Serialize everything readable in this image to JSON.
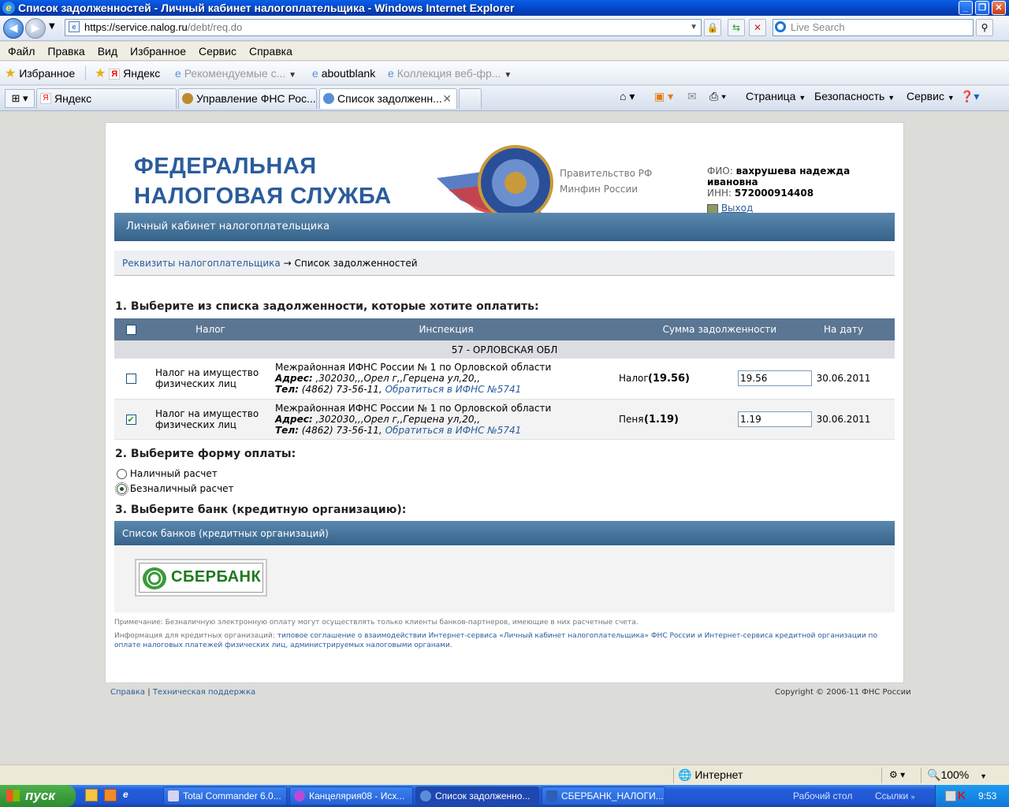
{
  "window": {
    "title": "Список задолженностей - Личный кабинет налогоплательщика - Windows Internet Explorer"
  },
  "address": {
    "domain": "https://service.nalog.ru",
    "path": "/debt/req.do"
  },
  "search": {
    "placeholder": "Live Search"
  },
  "menu": [
    "Файл",
    "Правка",
    "Вид",
    "Избранное",
    "Сервис",
    "Справка"
  ],
  "favbar": {
    "favorites": "Избранное",
    "items": [
      "Яндекс",
      "Рекомендуемые с...",
      "aboutblank",
      "Коллекция веб-фр..."
    ]
  },
  "tabs": [
    {
      "label": "Яндекс"
    },
    {
      "label": "Управление ФНС Рос..."
    },
    {
      "label": "Список задолженн..."
    }
  ],
  "toolbar": {
    "page": "Страница",
    "security": "Безопасность",
    "service": "Сервис"
  },
  "site": {
    "logo_line1": "ФЕДЕРАЛЬНАЯ",
    "logo_line2": "НАЛОГОВАЯ СЛУЖБА",
    "link_gov": "Правительство РФ",
    "link_minfin": "Минфин России",
    "user_fio_label": "ФИО:",
    "user_fio": "вахрушева надежда ивановна",
    "user_inn_label": "ИНН:",
    "user_inn": "572000914408",
    "logout": "Выход",
    "banner": "Личный кабинет налогоплательщика",
    "crumb_link": "Реквизиты налогоплательщика",
    "crumb_arrow": "→",
    "crumb_current": "Список задолженностей"
  },
  "step1": "1. Выберите из списка задолженности, которые хотите оплатить:",
  "table": {
    "headers": [
      "Налог",
      "Инспекция",
      "Сумма задолженности",
      "На дату"
    ],
    "region": "57 - ОРЛОВСКАЯ ОБЛ",
    "rows": [
      {
        "checked": false,
        "tax": "Налог на имущество физических лиц",
        "insp": "Межрайонная ИФНС России № 1 по Орловской области",
        "addr_label": "Адрес:",
        "addr": ",302030,,,Орел г,,Герцена ул,20,,",
        "tel_label": "Тел:",
        "tel": "(4862) 73-56-11,",
        "contact": "Обратиться в ИФНС №5741",
        "type": "Налог",
        "sum": "(19.56)",
        "value": "19.56",
        "date": "30.06.2011"
      },
      {
        "checked": true,
        "tax": "Налог на имущество физических лиц",
        "insp": "Межрайонная ИФНС России № 1 по Орловской области",
        "addr_label": "Адрес:",
        "addr": ",302030,,,Орел г,,Герцена ул,20,,",
        "tel_label": "Тел:",
        "tel": "(4862) 73-56-11,",
        "contact": "Обратиться в ИФНС №5741",
        "type": "Пеня",
        "sum": "(1.19)",
        "value": "1.19",
        "date": "30.06.2011"
      }
    ]
  },
  "step2": "2. Выберите форму оплаты:",
  "pay": {
    "cash": "Наличный расчет",
    "noncash": "Безналичный расчет"
  },
  "step3": "3. Выберите банк (кредитную организацию):",
  "banks": {
    "header": "Список банков (кредитных организаций)",
    "sber": "СБЕРБАНК"
  },
  "notes": {
    "note1": "Примечание: Безналичную электронную оплату могут осуществлять только клиенты банков-партнеров, имеющие в них расчетные счета.",
    "note2_prefix": "Информация для кредитных организаций:",
    "note2_link": "типовое соглашение о взаимодействии Интернет-сервиса «Личный кабинет налогоплательщика» ФНС России и Интернет-сервиса кредитной организации по оплате налоговых платежей физических лиц, администрируемых налоговыми органами."
  },
  "footer": {
    "help": "Справка",
    "sep": "|",
    "support": "Техническая поддержка",
    "copyright": "Copyright © 2006-11 ФНС России"
  },
  "status": {
    "zone": "Интернет",
    "zoom": "100%"
  },
  "taskbar": {
    "start": "пуск",
    "tasks": [
      "Total Commander 6.0...",
      "Канцелярия08 - Исх...",
      "Список задолженно...",
      "СБЕРБАНК_НАЛОГИ..."
    ],
    "desktop": "Рабочий стол",
    "links": "Ссылки",
    "time": "9:53"
  }
}
